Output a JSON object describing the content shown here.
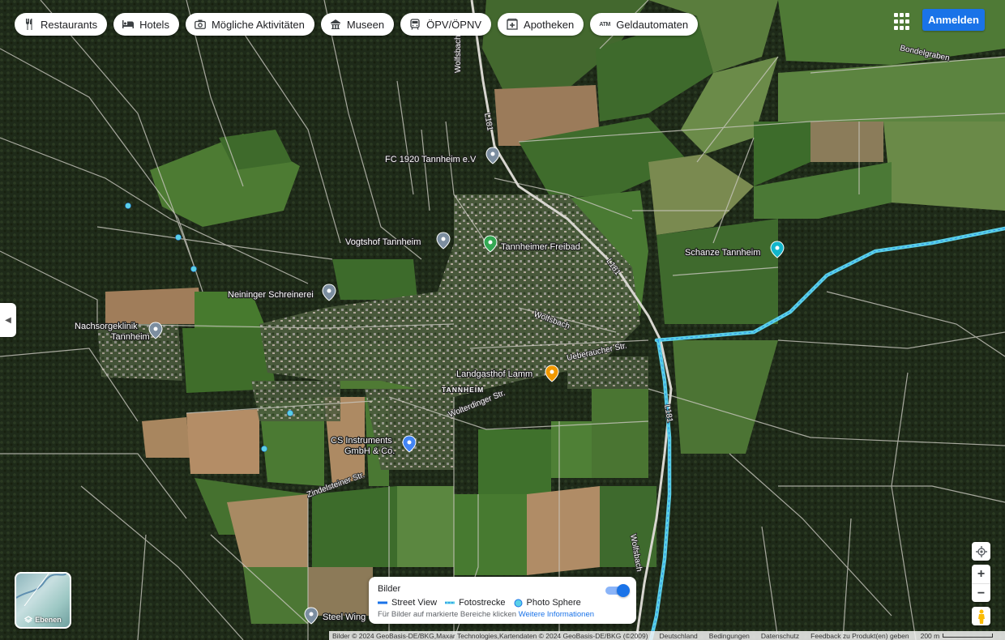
{
  "categories": [
    {
      "label": "Restaurants",
      "icon": "restaurant-icon"
    },
    {
      "label": "Hotels",
      "icon": "hotel-icon"
    },
    {
      "label": "Mögliche Aktivitäten",
      "icon": "camera-icon"
    },
    {
      "label": "Museen",
      "icon": "museum-icon"
    },
    {
      "label": "ÖPV/ÖPNV",
      "icon": "transit-icon"
    },
    {
      "label": "Apotheken",
      "icon": "pharmacy-icon"
    },
    {
      "label": "Geldautomaten",
      "icon": "atm-icon"
    }
  ],
  "header": {
    "signin_label": "Anmelden",
    "apps_icon": "apps-grid-icon"
  },
  "places": [
    {
      "name": "FC 1920 Tannheim e.V",
      "pin": "gray"
    },
    {
      "name": "Vogtshof Tannheim",
      "pin": "gray"
    },
    {
      "name": "Tannheimer Freibad",
      "pin": "green"
    },
    {
      "name": "Schanze Tannheim",
      "pin": "teal"
    },
    {
      "name": "Neininger Schreinerei",
      "pin": "gray"
    },
    {
      "name": "Nachsorgeklinik Tannheim",
      "pin": "gray"
    },
    {
      "name": "Landgasthof Lamm",
      "pin": "orange"
    },
    {
      "name": "CS Instruments GmbH & Co.",
      "pin": "blue"
    },
    {
      "name": "Steel Wing",
      "pin": "gray"
    }
  ],
  "streets": [
    "Wolfsbach",
    "L181",
    "L181",
    "L181",
    "Wolfsbach",
    "Ueberaucher Str.",
    "Wolterdinger Str.",
    "Zindelsteiner Str.",
    "Bondelgraben",
    "Wolfsbach"
  ],
  "town_label": "TANNHEIM",
  "layers": {
    "label": "Ebenen"
  },
  "street_view_panel": {
    "title": "Bilder",
    "legend": [
      "Street View",
      "Fotostrecke",
      "Photo Sphere"
    ],
    "note": "Für Bilder auf markierte Bereiche klicken",
    "link": "Weitere Informationen",
    "toggle_on": true
  },
  "footer": {
    "attribution": "Bilder © 2024 GeoBasis-DE/BKG,Maxar Technologies,Kartendaten © 2024 GeoBasis-DE/BKG (©2009)",
    "country": "Deutschland",
    "terms": "Bedingungen",
    "privacy": "Datenschutz",
    "feedback": "Feedback zu Produkt(en) geben",
    "scale": "200 m"
  },
  "colors": {
    "street_view": "#5ad0e8",
    "accent": "#1a73e8",
    "forest": "#1f2b1a",
    "field": "#4f7a36"
  }
}
